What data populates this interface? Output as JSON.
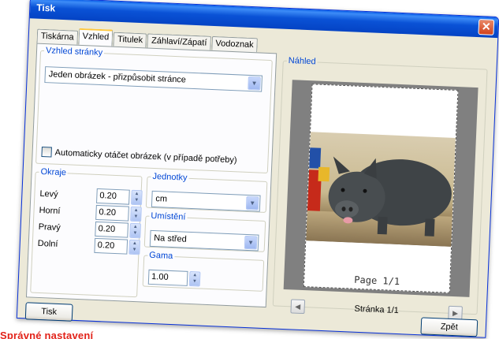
{
  "window": {
    "title": "Tisk",
    "close_symbol": "✕"
  },
  "tabs": [
    "Tiskárna",
    "Vzhled",
    "Titulek",
    "Záhlaví/Zápatí",
    "Vodoznak"
  ],
  "active_tab": "Vzhled",
  "page_layout": {
    "legend": "Vzhled stránky",
    "mode_value": "Jeden obrázek - přizpůsobit stránce",
    "auto_rotate_label": "Automaticky otáčet obrázek (v případě potřeby)",
    "auto_rotate_checked": false
  },
  "margins": {
    "legend": "Okraje",
    "rows": [
      {
        "label": "Levý",
        "value": "0.20"
      },
      {
        "label": "Horní",
        "value": "0.20"
      },
      {
        "label": "Pravý",
        "value": "0.20"
      },
      {
        "label": "Dolní",
        "value": "0.20"
      }
    ]
  },
  "units": {
    "legend": "Jednotky",
    "value": "cm"
  },
  "placement": {
    "legend": "Umístění",
    "value": "Na střed"
  },
  "gamma": {
    "legend": "Gama",
    "value": "1.00"
  },
  "preview": {
    "legend": "Náhled",
    "page_label": "Page  1/1",
    "nav_text": "Stránka  1/1",
    "prev_symbol": "◀",
    "next_symbol": "▶"
  },
  "buttons": {
    "print": "Tisk",
    "back": "Zpět"
  },
  "caption": "Správné nastavení"
}
